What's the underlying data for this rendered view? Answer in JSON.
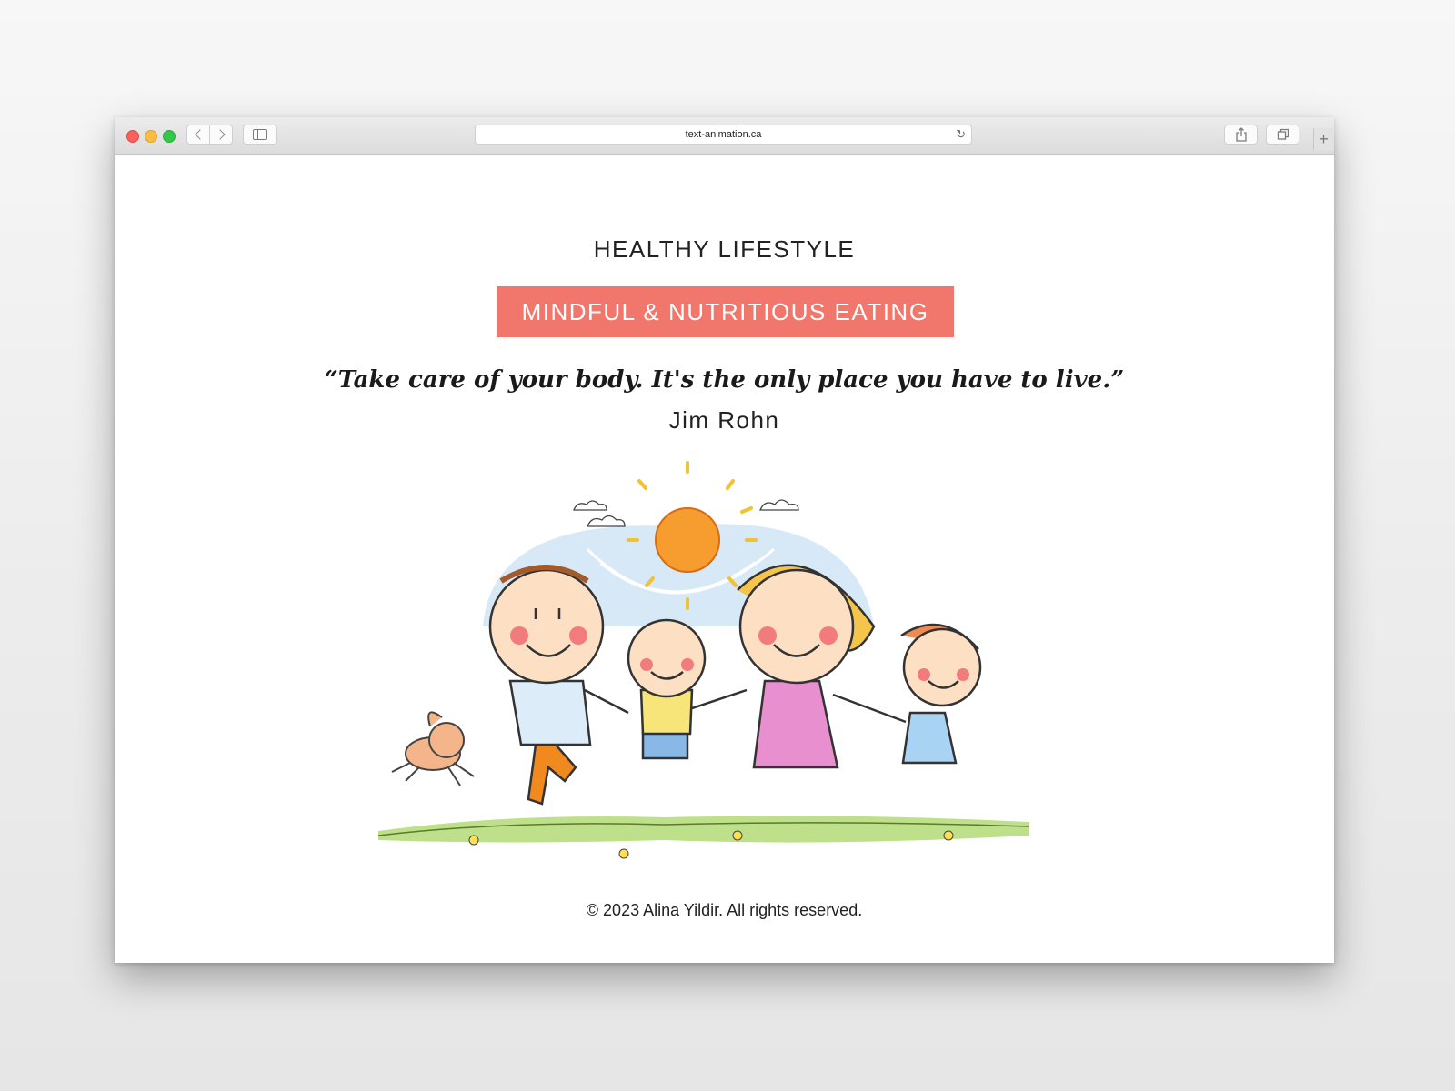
{
  "browser": {
    "url": "text-animation.ca",
    "icons": {
      "back": "chevron-left-icon",
      "forward": "chevron-right-icon",
      "sidebar": "sidebar-icon",
      "reload": "reload-icon",
      "share": "share-icon",
      "tabs": "tabs-overview-icon",
      "new_tab": "plus-icon"
    }
  },
  "page": {
    "eyebrow": "HEALTHY LIFESTYLE",
    "banner": "MINDFUL & NUTRITIOUS EATING",
    "quote": "“Take care of your body. It's the only place you have to live.”",
    "author": "Jim Rohn",
    "footer": "© 2023 Alina Yildir. All rights reserved."
  },
  "colors": {
    "banner_bg": "#f1766b",
    "banner_text": "#ffffff",
    "text": "#222222"
  }
}
